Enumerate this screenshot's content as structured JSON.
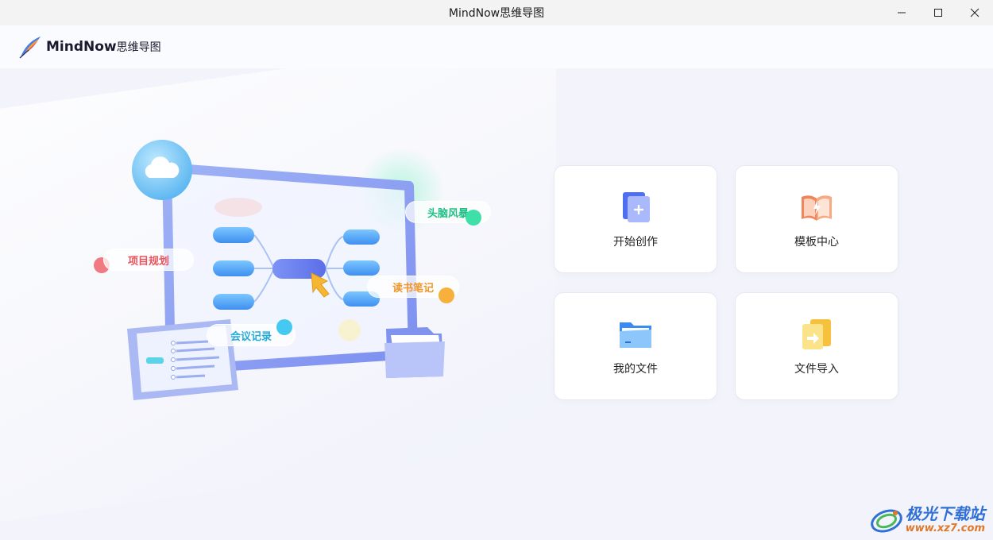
{
  "window": {
    "title": "MindNow思维导图",
    "controls": {
      "minimize_icon": "minimize-icon",
      "maximize_icon": "maximize-icon",
      "close_icon": "close-icon"
    }
  },
  "header": {
    "logo_icon": "feather-logo-icon",
    "brand": "MindNow",
    "brand_cn": "思维导图"
  },
  "illustration": {
    "tags": {
      "project": "项目规划",
      "brainstorm": "头脑风暴",
      "reading": "读书笔记",
      "meeting": "会议记录"
    },
    "icons": [
      "cloud-icon",
      "cursor-icon",
      "folder-icon",
      "document-icon"
    ]
  },
  "actions": [
    {
      "label": "开始创作",
      "icon": "new-document-icon"
    },
    {
      "label": "模板中心",
      "icon": "template-book-icon"
    },
    {
      "label": "我的文件",
      "icon": "folder-icon"
    },
    {
      "label": "文件导入",
      "icon": "import-file-icon"
    }
  ],
  "watermark": {
    "name": "极光下载站",
    "url": "www.xz7.com"
  },
  "colors": {
    "accent_blue": "#5b7cf2",
    "template_orange": "#f07a4e",
    "import_yellow": "#f6c23e",
    "tag_red": "#e8555e",
    "tag_green": "#1fcf8f",
    "tag_orange": "#f29a2e",
    "tag_cyan": "#2ab4e6"
  }
}
